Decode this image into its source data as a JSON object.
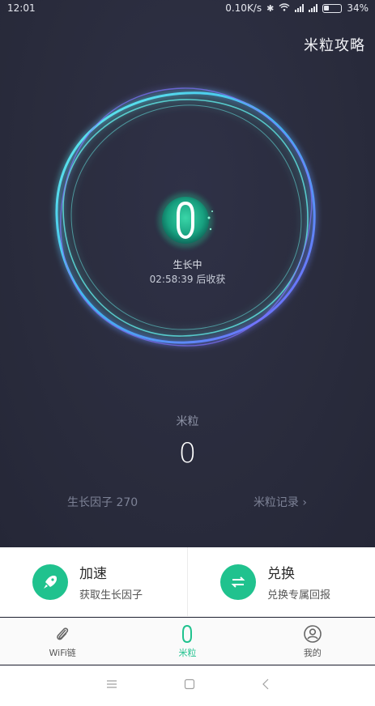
{
  "status_bar": {
    "time": "12:01",
    "net_speed": "0.10K/s",
    "battery": "34%"
  },
  "header": {
    "guide_label": "米粒攻略"
  },
  "growth": {
    "state": "生长中",
    "harvest_time": "02:58:39 后收获"
  },
  "mili": {
    "label": "米粒",
    "count": "0",
    "growth_factor": "生长因子  270",
    "record_link": "米粒记录"
  },
  "actions": [
    {
      "title": "加速",
      "subtitle": "获取生长因子",
      "icon": "rocket-icon"
    },
    {
      "title": "兑换",
      "subtitle": "兑换专属回报",
      "icon": "exchange-icon"
    }
  ],
  "tabs": [
    {
      "label": "WiFi链",
      "icon": "paperclip-icon",
      "active": false
    },
    {
      "label": "米粒",
      "icon": "grain-icon",
      "active": true
    },
    {
      "label": "我的",
      "icon": "user-icon",
      "active": false
    }
  ],
  "colors": {
    "accent": "#20c28e",
    "background": "#2b2d3d",
    "ring_cyan": "#4fe3e0",
    "ring_purple": "#7b6cff"
  },
  "system_nav": [
    "menu-icon",
    "home-icon",
    "back-icon"
  ]
}
